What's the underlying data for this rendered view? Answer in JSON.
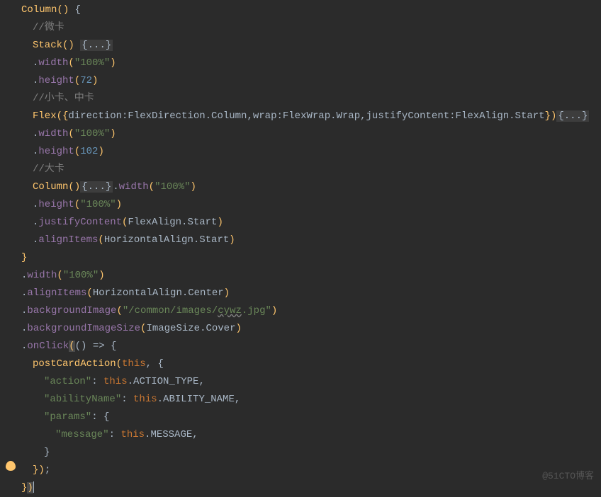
{
  "code": {
    "line1_fn": "Column",
    "line1_rest": "() {",
    "comment_weika": "//微卡",
    "stack_fn": "Stack",
    "stack_rest": "() ",
    "collapsed_braces": "{...}",
    "width_method": "width",
    "height_method": "height",
    "val_100pct": "\"100%\"",
    "val_72": "72",
    "comment_xiaoka": "//小卡、中卡",
    "flex_fn": "Flex",
    "flex_args_direction": "direction:FlexDirection.Column",
    "flex_args_wrap": "wrap:FlexWrap.Wrap",
    "flex_args_justify": "justifyContent:FlexAlign.Start",
    "val_102": "102",
    "comment_daka": "//大卡",
    "column_fn2": "Column",
    "justifyContent_method": "justifyContent",
    "flexAlign_start": "FlexAlign.Start",
    "alignItems_method": "alignItems",
    "horizontalAlign_start": "HorizontalAlign.Start",
    "horizontalAlign_center": "HorizontalAlign.Center",
    "backgroundImage_method": "backgroundImage",
    "bg_image_path_prefix": "\"/common/images/",
    "bg_image_cywz": "cywz",
    "bg_image_path_suffix": ".jpg\"",
    "backgroundImageSize_method": "backgroundImageSize",
    "imageSize_cover": "ImageSize.Cover",
    "onClick_method": "onClick",
    "arrow_fn": "() => {",
    "postCardAction_fn": "postCardAction",
    "this_kw": "this",
    "key_action": "\"action\"",
    "action_type": "ACTION_TYPE",
    "key_abilityName": "\"abilityName\"",
    "ability_name": "ABILITY_NAME",
    "key_params": "\"params\"",
    "key_message": "\"message\"",
    "message_prop": "MESSAGE"
  },
  "watermark": "@51CTO博客"
}
